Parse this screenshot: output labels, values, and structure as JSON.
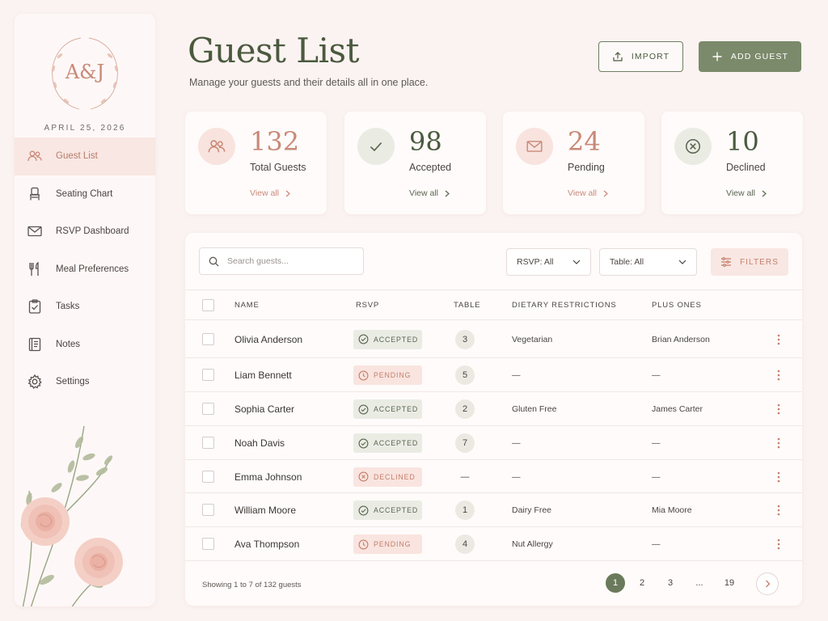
{
  "brand": {
    "monogram": "A&J",
    "date": "APRIL 25, 2026"
  },
  "sidebar": {
    "items": [
      {
        "label": "Guest List",
        "icon": "guests-icon",
        "active": true
      },
      {
        "label": "Seating Chart",
        "icon": "chair-icon"
      },
      {
        "label": "RSVP Dashboard",
        "icon": "envelope-icon"
      },
      {
        "label": "Meal Preferences",
        "icon": "utensils-icon"
      },
      {
        "label": "Tasks",
        "icon": "clipboard-check-icon"
      },
      {
        "label": "Notes",
        "icon": "notebook-icon"
      },
      {
        "label": "Settings",
        "icon": "gear-icon"
      }
    ]
  },
  "header": {
    "title": "Guest List",
    "subtitle": "Manage your guests and their details all in one place.",
    "import_label": "IMPORT",
    "add_label": "ADD GUEST"
  },
  "stats": [
    {
      "value": "132",
      "label": "Total Guests",
      "link": "View all",
      "icon": "guests-icon",
      "color": "#c98978"
    },
    {
      "value": "98",
      "label": "Accepted",
      "link": "View all",
      "icon": "check-icon",
      "color": "#5a6650"
    },
    {
      "value": "24",
      "label": "Pending",
      "link": "View all",
      "icon": "envelope-icon",
      "color": "#c98978"
    },
    {
      "value": "10",
      "label": "Declined",
      "link": "View all",
      "icon": "x-circle-icon",
      "color": "#5a6650"
    }
  ],
  "toolbar": {
    "search_placeholder": "Search guests...",
    "rsvp_filter": "RSVP: All",
    "table_filter": "Table: All",
    "filters_label": "FILTERS"
  },
  "table": {
    "columns": [
      "NAME",
      "RSVP",
      "TABLE",
      "DIETARY RESTRICTIONS",
      "PLUS ONES"
    ],
    "rows": [
      {
        "name": "Olivia Anderson",
        "rsvp": "ACCEPTED",
        "status": "accepted",
        "table": "3",
        "dietary": "Vegetarian",
        "plus_one": "Brian Anderson"
      },
      {
        "name": "Liam Bennett",
        "rsvp": "PENDING",
        "status": "pending",
        "table": "5",
        "dietary": "—",
        "plus_one": "—"
      },
      {
        "name": "Sophia Carter",
        "rsvp": "ACCEPTED",
        "status": "accepted",
        "table": "2",
        "dietary": "Gluten Free",
        "plus_one": "James Carter"
      },
      {
        "name": "Noah Davis",
        "rsvp": "ACCEPTED",
        "status": "accepted",
        "table": "7",
        "dietary": "—",
        "plus_one": "—"
      },
      {
        "name": "Emma Johnson",
        "rsvp": "DECLINED",
        "status": "declined",
        "table": "—",
        "dietary": "—",
        "plus_one": "—"
      },
      {
        "name": "William Moore",
        "rsvp": "ACCEPTED",
        "status": "accepted",
        "table": "1",
        "dietary": "Dairy Free",
        "plus_one": "Mia Moore"
      },
      {
        "name": "Ava Thompson",
        "rsvp": "PENDING",
        "status": "pending",
        "table": "4",
        "dietary": "Nut Allergy",
        "plus_one": "—"
      }
    ]
  },
  "footer": {
    "showing": "Showing 1 to 7 of 132 guests",
    "pages": [
      "1",
      "2",
      "3",
      "...",
      "19"
    ],
    "current_page": "1"
  },
  "colors": {
    "accent_green": "#7b8a6a",
    "accent_rose": "#c98978",
    "background": "#fbf3f1"
  }
}
